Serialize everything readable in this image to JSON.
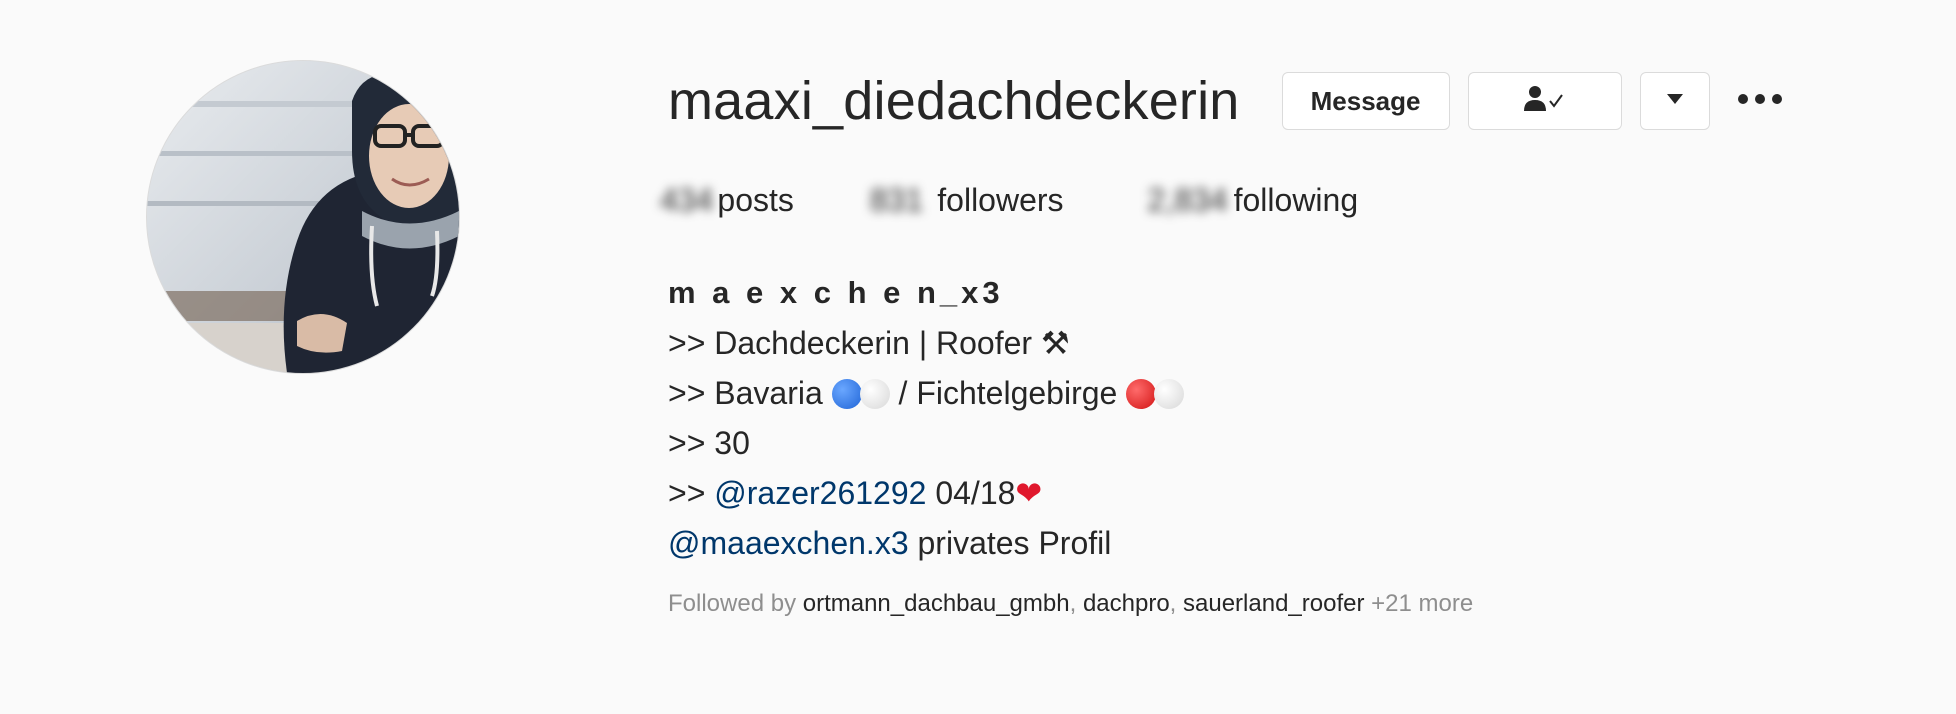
{
  "profile": {
    "username": "maaxi_diedachdeckerin",
    "avatar_icon": "profile-photo"
  },
  "actions": {
    "message_label": "Message",
    "follow_icon": "person-check-icon",
    "dropdown_icon": "caret-down-icon",
    "more_icon": "ellipsis-icon"
  },
  "stats": {
    "posts_count": "434",
    "posts_label": "posts",
    "followers_count": "831",
    "followers_label": "followers",
    "following_count": "2,834",
    "following_label": "following"
  },
  "bio": {
    "full_name": "m a e x c h e n_x3",
    "line1_prefix": ">> Dachdeckerin | Roofer ",
    "line1_emoji": "⚒",
    "line2_prefix": ">> Bavaria ",
    "line2_middle": " / Fichtelgebirge ",
    "line3": ">> 30",
    "line4_prefix": ">> ",
    "line4_mention": "@razer261292",
    "line4_suffix": " 04/18",
    "line4_heart": "❤",
    "line5_mention": "@maaexchen.x3",
    "line5_suffix": " privates Profil"
  },
  "followed_by": {
    "prefix": "Followed by ",
    "users": [
      "ortmann_dachbau_gmbh",
      "dachpro",
      "sauerland_roofer"
    ],
    "separator": ", ",
    "more": " +21 more"
  },
  "colors": {
    "background": "#fafafa",
    "text": "#262626",
    "link": "#00376b",
    "secondary": "#8e8e8e",
    "border": "#dbdbdb"
  }
}
